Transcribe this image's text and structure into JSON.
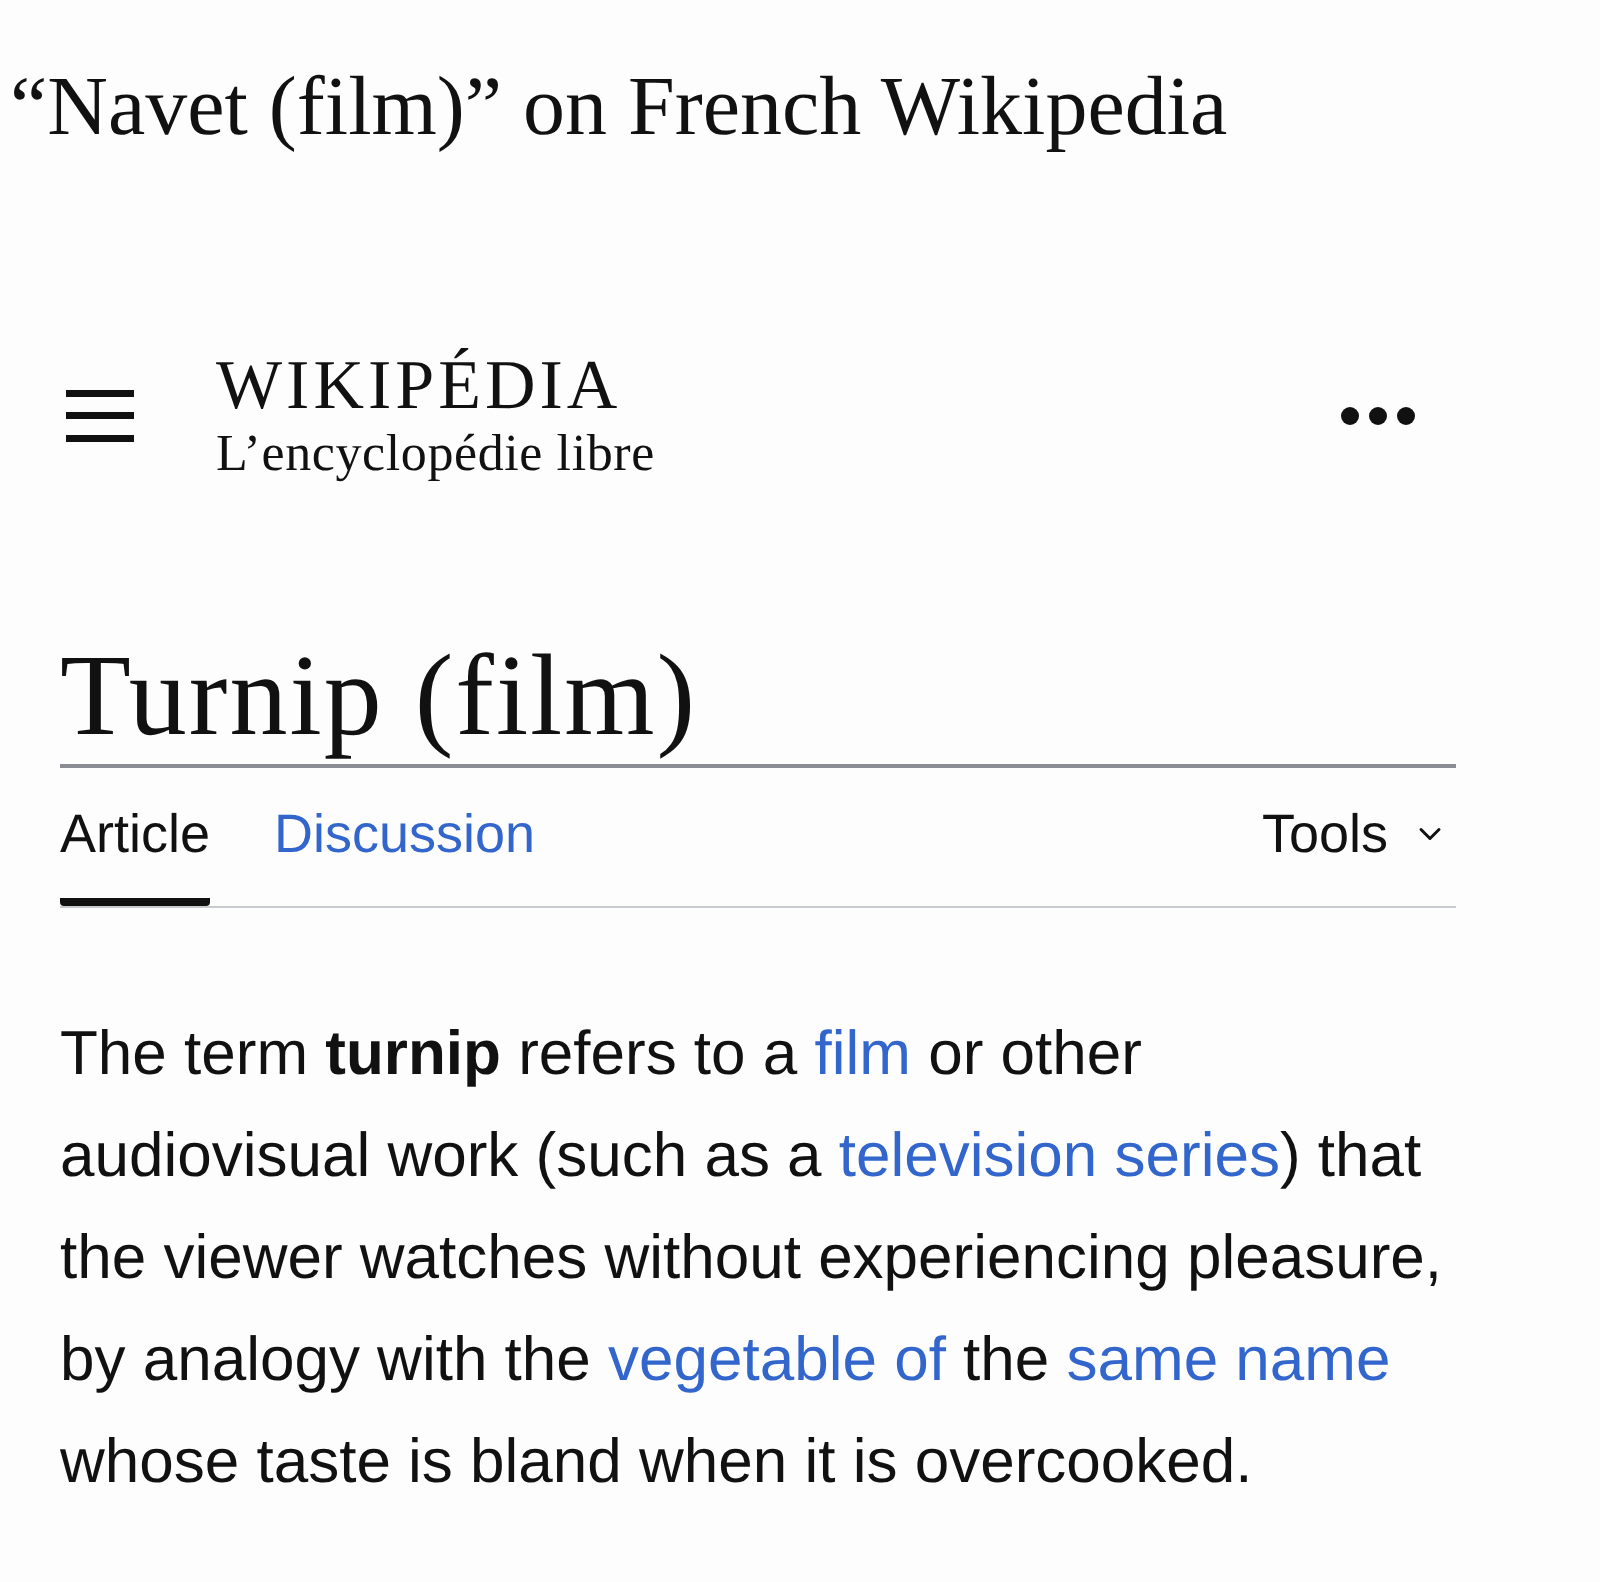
{
  "caption": "“Navet (film)” on French Wikipedia",
  "header": {
    "logo_wordmark": "WIKIPÉDIA",
    "logo_tagline": "L’encyclopédie libre"
  },
  "page_title": "Turnip (film)",
  "tabs": [
    {
      "label": "Article",
      "selected": true
    },
    {
      "label": "Discussion",
      "selected": false
    }
  ],
  "tools_menu": {
    "label": "Tools"
  },
  "paragraph": [
    {
      "kind": "text",
      "text": "The term "
    },
    {
      "kind": "bold",
      "text": "turnip"
    },
    {
      "kind": "text",
      "text": " refers to a "
    },
    {
      "kind": "link",
      "text": "film"
    },
    {
      "kind": "text",
      "text": " or other audiovisual work (such as a "
    },
    {
      "kind": "link",
      "text": "television series"
    },
    {
      "kind": "text",
      "text": ") that the viewer watches without experiencing pleasure, by analogy with the "
    },
    {
      "kind": "link",
      "text": "vegetable of"
    },
    {
      "kind": "text",
      "text": " the "
    },
    {
      "kind": "link",
      "text": "same name"
    },
    {
      "kind": "text",
      "text": " whose taste is bland when it is overcooked."
    }
  ]
}
